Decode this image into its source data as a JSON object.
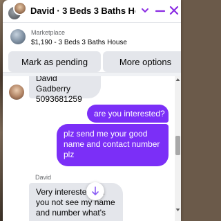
{
  "header": {
    "title": "David · 3 Beds 3 Baths Ho...",
    "chevron_icon": "chevron-down-icon",
    "minimize_icon": "minimize-icon",
    "close_icon": "close-icon",
    "accent_color": "#8a2be2"
  },
  "marketplace": {
    "label": "Marketplace",
    "item": "$1,190 - 3 Beds 3 Baths House",
    "buttons": {
      "mark_pending": "Mark as pending",
      "more_options": "More options"
    }
  },
  "messages": [
    {
      "direction": "incoming",
      "lines": [
        "David Gadberry",
        "5093681259"
      ]
    },
    {
      "direction": "outgoing",
      "lines": [
        "are you interested?"
      ]
    },
    {
      "direction": "outgoing",
      "lines": [
        "plz send me your good",
        "name and contact number",
        "plz"
      ]
    },
    {
      "direction": "incoming",
      "sender": "David",
      "lines": [
        "Very interested did",
        "you not see my name",
        "and number what's"
      ]
    }
  ],
  "colors": {
    "outgoing_bubble": "#7b2ff7",
    "incoming_bubble": "#e4e6eb"
  }
}
